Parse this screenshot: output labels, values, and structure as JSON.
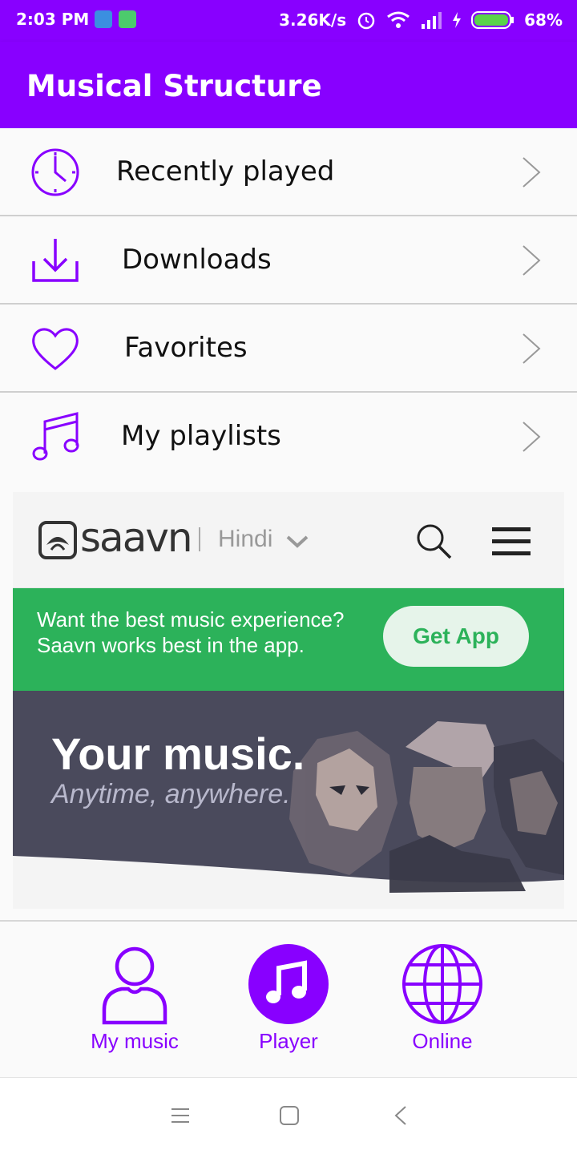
{
  "status_bar": {
    "time": "2:03 PM",
    "speed": "3.26K/s",
    "battery": "68%"
  },
  "app_bar": {
    "title": "Musical Structure"
  },
  "menu": {
    "items": [
      {
        "label": "Recently played",
        "icon": "clock-icon"
      },
      {
        "label": "Downloads",
        "icon": "download-icon"
      },
      {
        "label": "Favorites",
        "icon": "heart-icon"
      },
      {
        "label": "My playlists",
        "icon": "music-note-icon"
      }
    ]
  },
  "web": {
    "brand": "saavn",
    "language": "Hindi",
    "promo_line1": "Want the best music experience?",
    "promo_line2": "Saavn works best in the app.",
    "get_app": "Get App",
    "hero_title": "Your music.",
    "hero_subtitle": "Anytime, anywhere."
  },
  "bottom_nav": {
    "tabs": [
      {
        "label": "My music",
        "icon": "person-icon"
      },
      {
        "label": "Player",
        "icon": "music-note-icon"
      },
      {
        "label": "Online",
        "icon": "globe-icon"
      }
    ]
  },
  "colors": {
    "primary": "#8800ff",
    "promo_green": "#2cb25a",
    "hero_bg": "#4a4a5c"
  }
}
